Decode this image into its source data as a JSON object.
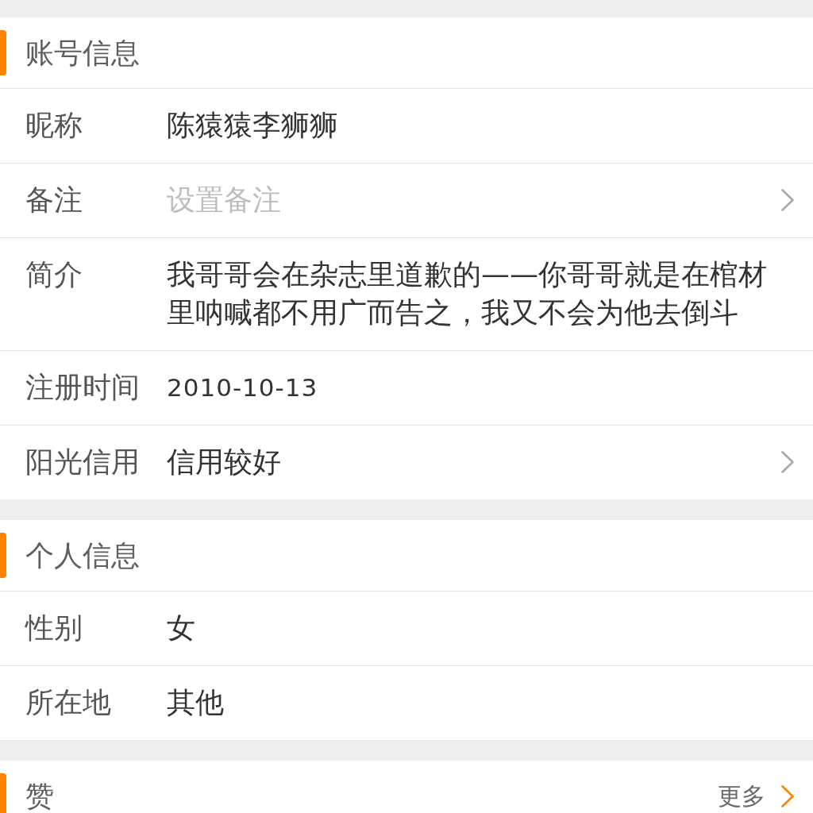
{
  "sections": [
    {
      "title": "账号信息",
      "rows": [
        {
          "label": "昵称",
          "value": "陈猿猿李狮狮",
          "chevron": false
        },
        {
          "label": "备注",
          "placeholder": "设置备注",
          "chevron": true
        },
        {
          "label": "简介",
          "value": "我哥哥会在杂志里道歉的——你哥哥就是在棺材里呐喊都不用广而告之，我又不会为他去倒斗",
          "chevron": false
        },
        {
          "label": "注册时间",
          "value": "2010-10-13",
          "chevron": false
        },
        {
          "label": "阳光信用",
          "value": "信用较好",
          "chevron": true
        }
      ]
    },
    {
      "title": "个人信息",
      "rows": [
        {
          "label": "性别",
          "value": "女",
          "chevron": false
        },
        {
          "label": "所在地",
          "value": "其他",
          "chevron": false
        }
      ]
    },
    {
      "title": "赞",
      "more": "更多"
    }
  ]
}
